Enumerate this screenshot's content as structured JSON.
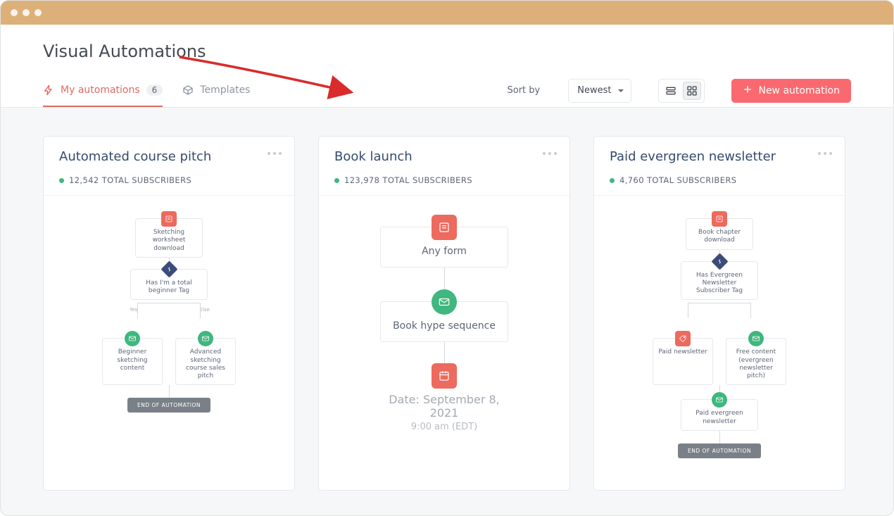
{
  "page": {
    "title": "Visual Automations"
  },
  "tabs": {
    "my": {
      "label": "My automations",
      "count": "6"
    },
    "templates": {
      "label": "Templates"
    }
  },
  "toolbar": {
    "sort_label": "Sort by",
    "sort_value": "Newest",
    "new_btn": "New automation"
  },
  "cards": [
    {
      "title": "Automated course pitch",
      "subs": "12,542 TOTAL SUBSCRIBERS",
      "flow": {
        "trigger": "Sketching worksheet download",
        "cond": "Has I'm a total beginner Tag",
        "yes_label": "Yes",
        "else_label": "Else",
        "left": "Beginner sketching content",
        "right": "Advanced sketching course sales pitch",
        "end": "END OF AUTOMATION"
      }
    },
    {
      "title": "Book launch",
      "subs": "123,978 TOTAL SUBSCRIBERS",
      "flow": {
        "trigger": "Any form",
        "seq": "Book hype sequence",
        "date1": "Date: September 8, 2021",
        "date2": "9:00 am (EDT)"
      }
    },
    {
      "title": "Paid evergreen newsletter",
      "subs": "4,760 TOTAL SUBSCRIBERS",
      "flow": {
        "trigger": "Book chapter download",
        "cond": "Has Evergreen Newsletter Subscriber Tag",
        "left": "Paid newsletter",
        "right": "Free content (evergreen newsletter pitch)",
        "seq": "Paid evergreen newsletter",
        "end": "END OF AUTOMATION"
      }
    }
  ]
}
